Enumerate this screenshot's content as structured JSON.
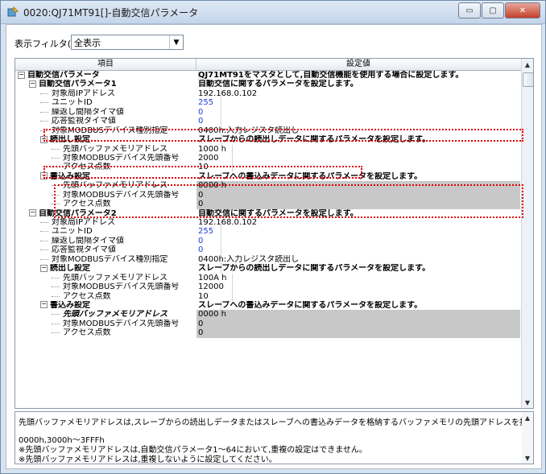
{
  "window": {
    "title": "0020:QJ71MT91[]-自動交信パラメータ",
    "minimize": "▭",
    "maximize": "▢",
    "close": "✕"
  },
  "filter": {
    "label": "表示フィルタ(R)",
    "value": "全表示"
  },
  "grid": {
    "headers": [
      "項目",
      "設定値"
    ],
    "rows": [
      {
        "indent": 0,
        "exp": "⊟",
        "name": "自動交信パラメータ",
        "value": "QJ71MT91をマスタとして,自動交信機能を使用する場合に設定します。",
        "bold": true,
        "style": ""
      },
      {
        "indent": 1,
        "exp": "⊟",
        "name": "自動交信パラメータ1",
        "value": "自動交信に関するパラメータを設定します。",
        "bold": true,
        "style": ""
      },
      {
        "indent": 2,
        "exp": "",
        "name": "対象局IPアドレス",
        "value": "192.168.0.102",
        "bold": false,
        "style": ""
      },
      {
        "indent": 2,
        "exp": "",
        "name": "ユニットID",
        "value": "255",
        "bold": false,
        "style": "blue"
      },
      {
        "indent": 2,
        "exp": "",
        "name": "繰返し間隔タイマ値",
        "value": "0",
        "bold": false,
        "style": "blue"
      },
      {
        "indent": 2,
        "exp": "",
        "name": "応答監視タイマ値",
        "value": "0",
        "bold": false,
        "style": "blue"
      },
      {
        "indent": 2,
        "exp": "",
        "name": "対象MODBUSデバイス種別指定",
        "value": "0400h:入力レジスタ読出し",
        "bold": false,
        "style": ""
      },
      {
        "indent": 2,
        "exp": "⊟",
        "name": "読出し設定",
        "value": "スレーブからの読出しデータに関するパラメータを設定します。",
        "bold": true,
        "style": ""
      },
      {
        "indent": 3,
        "exp": "",
        "name": "先頭バッファメモリアドレス",
        "value": "1000 h",
        "bold": false,
        "style": ""
      },
      {
        "indent": 3,
        "exp": "",
        "name": "対象MODBUSデバイス先頭番号",
        "value": "2000",
        "bold": false,
        "style": ""
      },
      {
        "indent": 3,
        "exp": "",
        "name": "アクセス点数",
        "value": "10",
        "bold": false,
        "style": ""
      },
      {
        "indent": 2,
        "exp": "⊟",
        "name": "書込み設定",
        "value": "スレーブへの書込みデータに関するパラメータを設定します。",
        "bold": true,
        "style": ""
      },
      {
        "indent": 3,
        "exp": "",
        "name": "先頭バッファメモリアドレス",
        "value": "0000 h",
        "bold": false,
        "style": "gray"
      },
      {
        "indent": 3,
        "exp": "",
        "name": "対象MODBUSデバイス先頭番号",
        "value": "0",
        "bold": false,
        "style": "gray"
      },
      {
        "indent": 3,
        "exp": "",
        "name": "アクセス点数",
        "value": "0",
        "bold": false,
        "style": "gray"
      },
      {
        "indent": 1,
        "exp": "⊟",
        "name": "自動交信パラメータ2",
        "value": "自動交信に関するパラメータを設定します。",
        "bold": true,
        "style": ""
      },
      {
        "indent": 2,
        "exp": "",
        "name": "対象局IPアドレス",
        "value": "192.168.0.102",
        "bold": false,
        "style": ""
      },
      {
        "indent": 2,
        "exp": "",
        "name": "ユニットID",
        "value": "255",
        "bold": false,
        "style": "blue"
      },
      {
        "indent": 2,
        "exp": "",
        "name": "繰返し間隔タイマ値",
        "value": "0",
        "bold": false,
        "style": "blue"
      },
      {
        "indent": 2,
        "exp": "",
        "name": "応答監視タイマ値",
        "value": "0",
        "bold": false,
        "style": "blue"
      },
      {
        "indent": 2,
        "exp": "",
        "name": "対象MODBUSデバイス種別指定",
        "value": "0400h:入力レジスタ読出し",
        "bold": false,
        "style": ""
      },
      {
        "indent": 2,
        "exp": "⊟",
        "name": "読出し設定",
        "value": "スレーブからの読出しデータに関するパラメータを設定します。",
        "bold": true,
        "style": ""
      },
      {
        "indent": 3,
        "exp": "",
        "name": "先頭バッファメモリアドレス",
        "value": "100A h",
        "bold": false,
        "style": ""
      },
      {
        "indent": 3,
        "exp": "",
        "name": "対象MODBUSデバイス先頭番号",
        "value": "12000",
        "bold": false,
        "style": ""
      },
      {
        "indent": 3,
        "exp": "",
        "name": "アクセス点数",
        "value": "10",
        "bold": false,
        "style": ""
      },
      {
        "indent": 2,
        "exp": "⊟",
        "name": "書込み設定",
        "value": "スレーブへの書込みデータに関するパラメータを設定します。",
        "bold": true,
        "style": ""
      },
      {
        "indent": 3,
        "exp": "",
        "name": "先頭バッファメモリアドレス",
        "value": "0000 h",
        "bold": false,
        "style": "gray",
        "italic": true
      },
      {
        "indent": 3,
        "exp": "",
        "name": "対象MODBUSデバイス先頭番号",
        "value": "0",
        "bold": false,
        "style": "gray"
      },
      {
        "indent": 3,
        "exp": "",
        "name": "アクセス点数",
        "value": "0",
        "bold": false,
        "style": "gray"
      }
    ]
  },
  "description": {
    "line1": "先頭バッファメモリアドレスは,スレーブからの読出しデータまたはスレーブへの書込みデータを格納するバッファメモリの先頭アドレスを指定します。",
    "line2": "0000h,3000h～3FFFh",
    "line3": "※先頭バッファメモリアドレスは,自動交信パラメータ1～64において,重複の設定はできません。",
    "line4": "※先頭バッファメモリアドレスは,重複しないように設定してください。"
  },
  "colors": {
    "highlight": "#e00000",
    "blue_value": "#1f3fd6",
    "gray_cell": "#c8c8c8"
  }
}
